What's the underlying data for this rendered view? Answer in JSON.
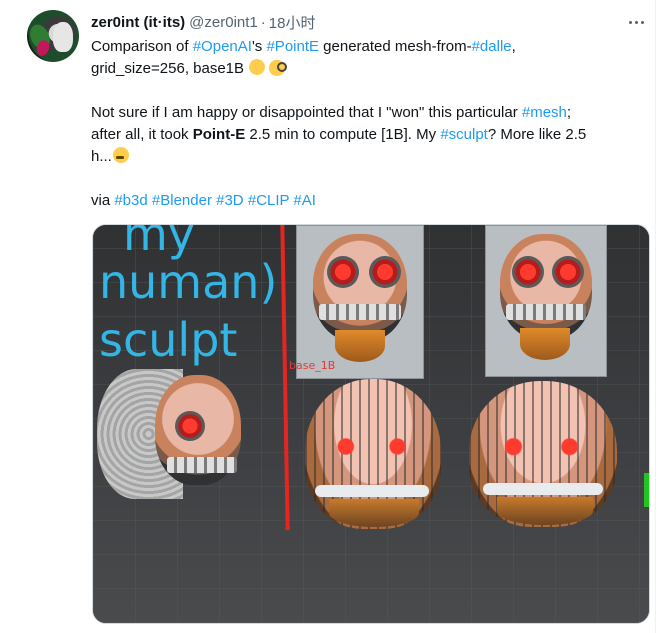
{
  "author": {
    "display_name": "zer0int (it·its)",
    "handle": "@zer0int1",
    "separator": "·",
    "timestamp": "18小时"
  },
  "tweet": {
    "line1_a": "Comparison of ",
    "tag_openai": "#OpenAI",
    "line1_b": "'s ",
    "tag_pointe": "#PointE",
    "line1_c": " generated mesh-from-",
    "tag_dalle": "#dalle",
    "line1_d": ",",
    "line2": "grid_size=256, base1B ",
    "p2_a": "Not sure if I am happy or disappointed that I \"won\" this particular ",
    "tag_mesh": "#mesh",
    "p2_b": ";",
    "p2_c": "after all, it took ",
    "p2_bold": "Point-E",
    "p2_d": " 2.5 min to compute [1B]. My ",
    "tag_sculpt": "#sculpt",
    "p2_e": "? More like 2.5",
    "p2_f": "h...",
    "p3_a": "via ",
    "tags_via": [
      "#b3d",
      "#Blender",
      "#3D",
      "#CLIP",
      "#AI"
    ]
  },
  "emoji": {
    "first": "backhand-index-pointing-left",
    "second": "face-with-monocle",
    "third": "thinking-face"
  },
  "media": {
    "overlay_line1": "my",
    "overlay_line2": "numan)",
    "overlay_line3": "sculpt",
    "object_label": "base_1B"
  },
  "colors": {
    "link": "#1d9bf0",
    "text": "#0f1419",
    "muted": "#536471",
    "overlay_text": "#33b5e5",
    "marker_red": "#e52521"
  }
}
